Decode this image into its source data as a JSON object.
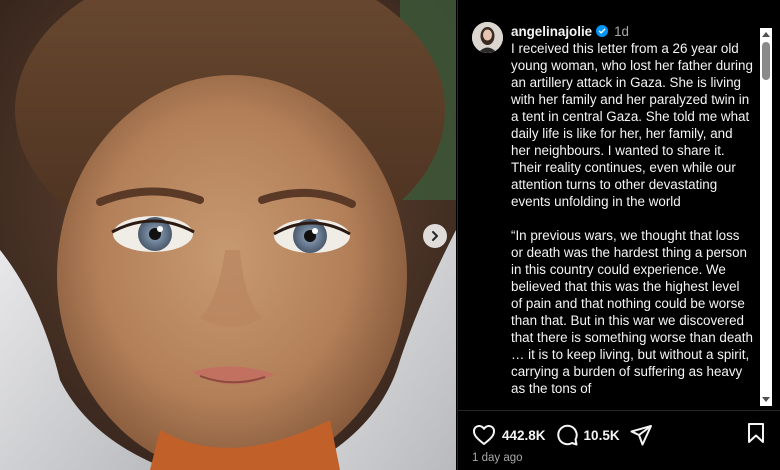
{
  "post": {
    "username": "angelinajolie",
    "time_short": "1d",
    "caption_p1": "I received this letter from a 26 year old young woman, who lost her father during an artillery attack in Gaza. She is living with her family and her paralyzed twin in a tent in central Gaza. She told me what daily life is like for her, her family, and her neighbours. I wanted to share it. Their reality continues, even while our attention turns to other devastating events unfolding in the world",
    "caption_p2": "“In previous wars, we thought that loss or death was the hardest thing a person in this country could experience. We believed that this was the highest level of pain and that nothing could be worse than that. But in this war we discovered that there is something worse than death … it is to keep living, but without a spirit, carrying a burden of suffering as heavy as the tons of",
    "likes": "442.8K",
    "comments": "10.5K",
    "time_long": "1 day ago"
  },
  "icons": {
    "verified": "verified-badge-icon",
    "next": "chevron-right-icon",
    "like": "heart-icon",
    "comment": "comment-bubble-icon",
    "share": "paper-plane-icon",
    "save": "bookmark-icon"
  },
  "colors": {
    "background": "#000000",
    "text": "#f5f5f5",
    "muted": "#a8a8a8",
    "verified": "#0095f6"
  }
}
